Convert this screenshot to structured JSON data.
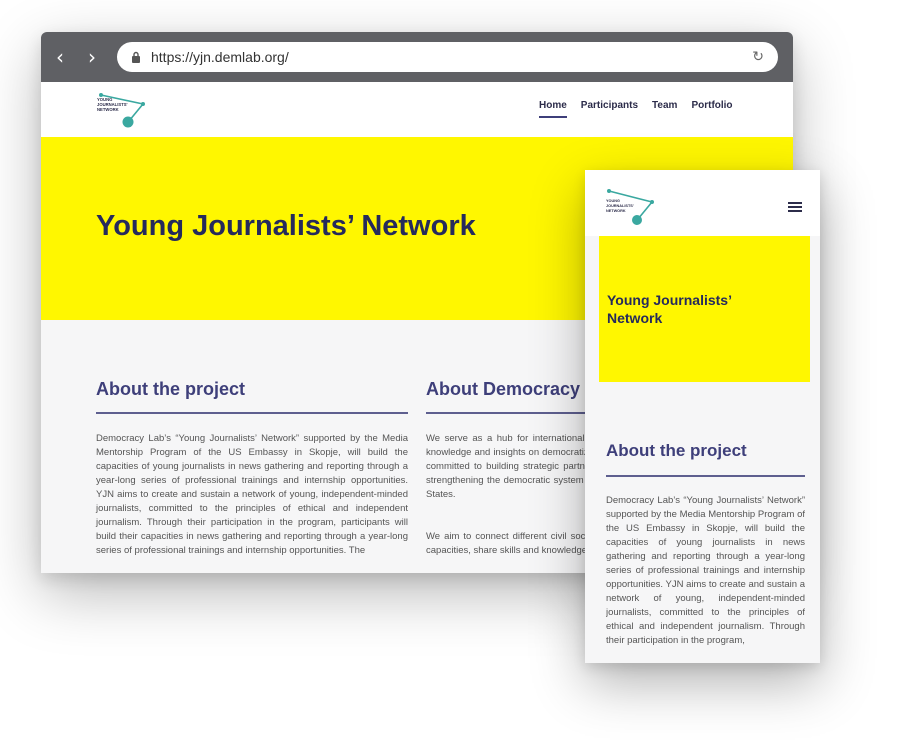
{
  "desktop": {
    "browser": {
      "back_icon": "chevron-left-icon",
      "forward_icon": "chevron-right-icon",
      "url": "https://yjn.demlab.org/",
      "lock_icon": "lock-icon",
      "reload_icon": "reload-icon"
    },
    "logo": {
      "line1": "YOUNG",
      "line2": "JOURNALISTS'",
      "line3": "NETWORK"
    },
    "nav": [
      {
        "label": "Home",
        "active": true
      },
      {
        "label": "Participants"
      },
      {
        "label": "Team"
      },
      {
        "label": "Portfolio"
      }
    ],
    "hero": {
      "title": "Young Journalists’ Network",
      "color": "#fff700"
    },
    "about_project": {
      "title": "About the project",
      "text": "Democracy Lab’s “Young Journalists’ Network” supported by the Media Mentorship Program of the US Embassy in Skopje, will build the capacities of young journalists in news gathering and reporting through a year-long series of professional trainings and internship opportunities. YJN aims to create and sustain a network of young, independent-minded journalists, committed to the principles of ethical and independent journalism. Through their participation in the program, participants will build their capacities in news gathering and reporting through a year-long series of professional trainings and internship opportunities. The"
    },
    "about_democracy": {
      "title": "About Democracy Lab",
      "para1": "We serve as a hub for international and local experts who share their knowledge and insights on democratization processes. Democracy Lab is committed to building strategic partnerships focused on developing and strengthening the democratic system in North Macedonia and the United States.",
      "para2": "We aim to connect different civil society actors to enhance their human capacities, share skills and knowledge, build coalitions and networks."
    }
  },
  "mobile": {
    "logo": {
      "line1": "YOUNG",
      "line2": "JOURNALISTS'",
      "line3": "NETWORK"
    },
    "menu_icon": "hamburger-menu-icon",
    "hero_title": "Young Journalists’ Network",
    "about_title": "About the project",
    "about_text": "Democracy Lab’s “Young Journalists’ Network” supported by the Media Mentorship Program of the US Embassy in Skopje, will build the capacities of young journalists in news gathering and reporting through a year-long series of professional trainings and internship opportunities. YJN aims to create and sustain a network of young, independent-minded journalists, committed to the principles of ethical and independent journalism. Through their participation in the program,"
  },
  "colors": {
    "brand_yellow": "#fff700",
    "heading_navy": "#252a5c",
    "accent_purple": "#3e3f7a",
    "logo_teal": "#3aa8a0",
    "chrome_gray": "#5f6064"
  }
}
